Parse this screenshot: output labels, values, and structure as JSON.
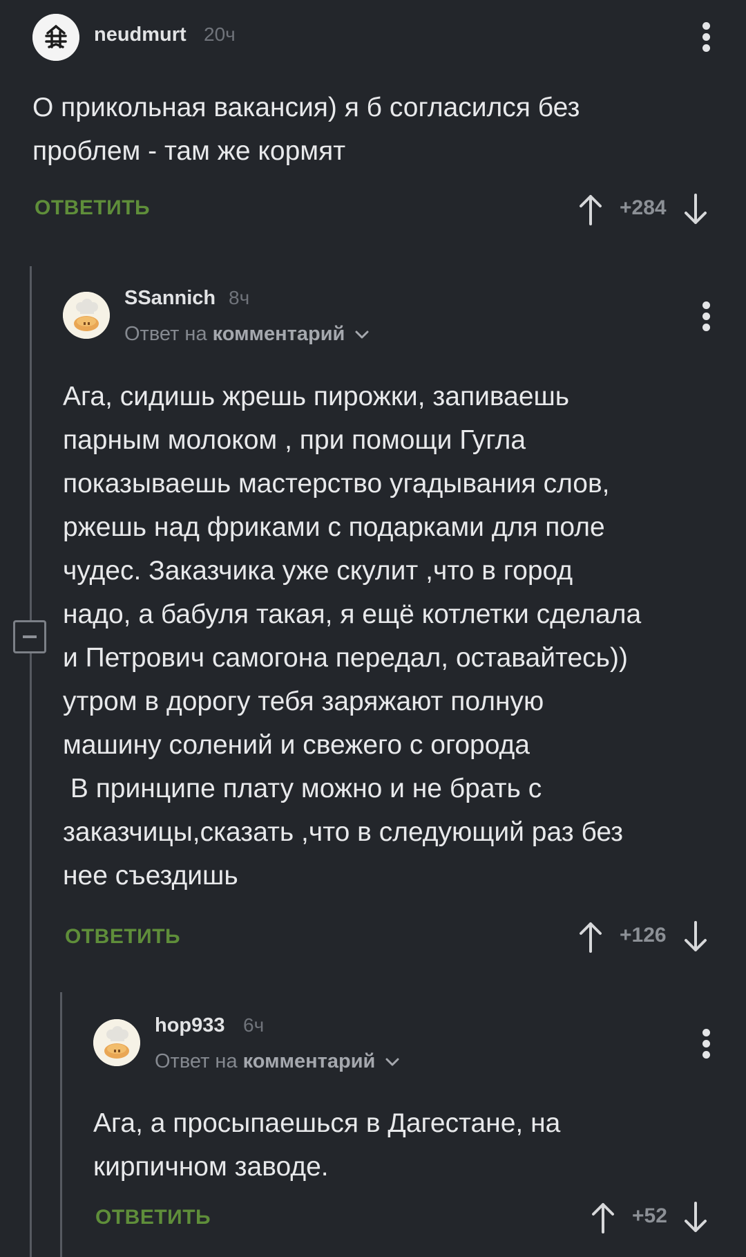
{
  "comments": [
    {
      "author": "neudmurt",
      "time": "20ч",
      "text": "О прикольная вакансия) я б согласился без\nпроблем - там же кормят",
      "reply_label": "ОТВЕТИТЬ",
      "score": "+284"
    },
    {
      "author": "SSannich",
      "time": "8ч",
      "reply_prefix": "Ответ на",
      "reply_target": "комментарий",
      "text": "Ага, сидишь жрешь пирожки, запиваешь\nпарным молоком , при помощи Гугла\nпоказываешь мастерство угадывания слов,\nржешь над фриками с подарками для поле\nчудес. Заказчика уже скулит ,что в город\nнадо, а бабуля такая, я ещё котлетки сделала\nи Петрович самогона передал, оставайтесь))\nутром в дорогу тебя заряжают полную\nмашину солений и свежего с огорода\n В принципе плату можно и не брать с\nзаказчицы,сказать ,что в следующий раз без\nнее съездишь",
      "reply_label": "ОТВЕТИТЬ",
      "score": "+126"
    },
    {
      "author": "hop933",
      "time": "6ч",
      "reply_prefix": "Ответ на",
      "reply_target": "комментарий",
      "text": "Ага, а просыпаешься в Дагестане, на\nкирпичном заводе.",
      "reply_label": "ОТВЕТИТЬ",
      "score": "+52"
    }
  ],
  "icons": {
    "upvote": "arrow-up-icon",
    "downvote": "arrow-down-icon",
    "menu": "more-vertical-icon",
    "collapse": "collapse-minus-icon",
    "chevron": "chevron-down-icon"
  },
  "colors": {
    "background": "#23262b",
    "accent_green": "#5f8e3a",
    "thread_line": "#565a61"
  }
}
